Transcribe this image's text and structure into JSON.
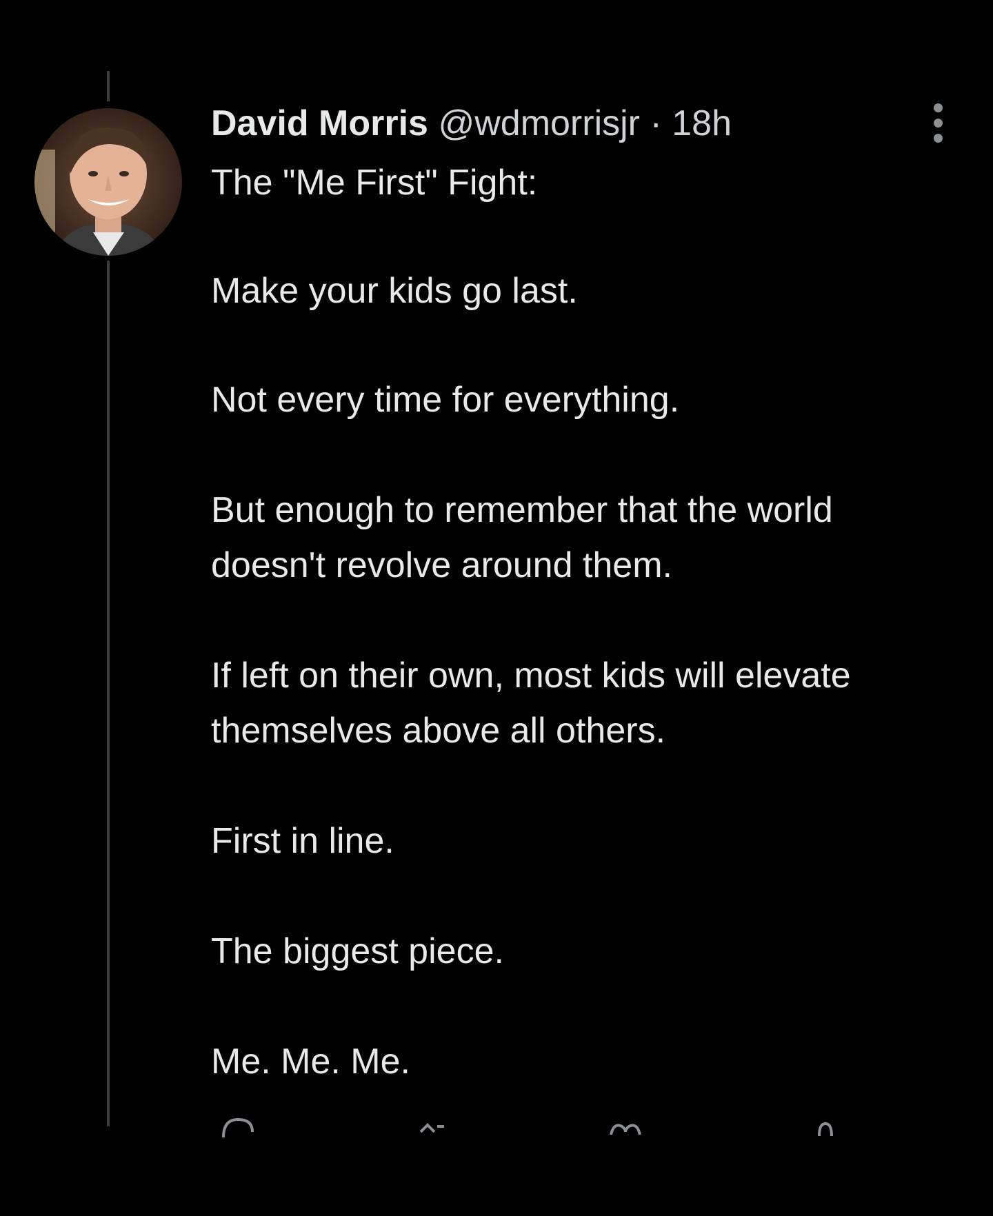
{
  "tweet": {
    "author": {
      "display_name": "David Morris",
      "handle": "@wdmorrisjr"
    },
    "separator": "·",
    "time": "18h",
    "lines": [
      "The \"Me First\" Fight:",
      "Make your kids go last.",
      "Not every time for everything.",
      "But enough to remember that the world",
      "doesn't revolve around them.",
      "If left on their own, most kids will elevate",
      "themselves above all others.",
      "First in line.",
      "The biggest piece.",
      "Me. Me. Me."
    ]
  },
  "icons": {
    "more": "more-vertical-icon",
    "actions": [
      "reply-icon",
      "retweet-icon",
      "like-icon",
      "share-icon"
    ]
  },
  "colors": {
    "background": "#000000",
    "text": "#e7e9ea",
    "thread_line": "#3a3d40"
  }
}
